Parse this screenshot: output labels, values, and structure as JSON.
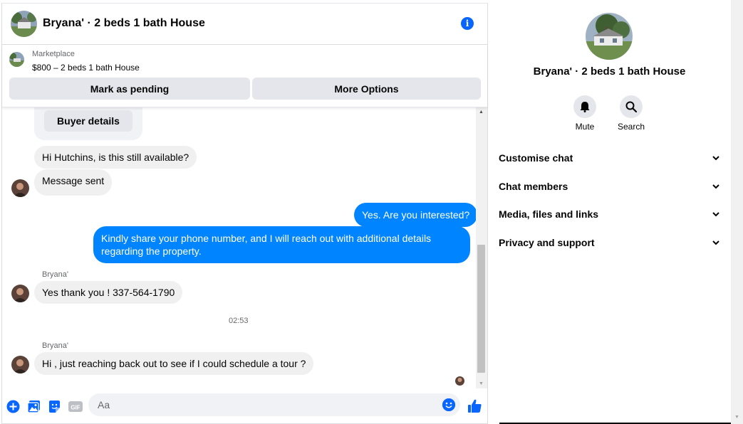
{
  "header": {
    "title": "Bryana' · 2 beds 1 bath House"
  },
  "listing": {
    "kind": "Marketplace",
    "summary": "$800 – 2 beds 1 bath House",
    "mark_pending_label": "Mark as pending",
    "more_options_label": "More Options"
  },
  "thread": {
    "buyer_details_label": "Buyer details",
    "messages": [
      {
        "direction": "in",
        "text": "Hi Hutchins, is this still available?"
      },
      {
        "direction": "in",
        "text": "Message sent"
      },
      {
        "direction": "out",
        "text": "Yes. Are you interested?"
      },
      {
        "direction": "out",
        "text": "Kindly share your phone number, and I will reach out with additional details regarding the property."
      },
      {
        "direction": "in",
        "sender": "Bryana'",
        "text": "Yes thank you !  337-564-1790"
      },
      {
        "direction": "in",
        "sender": "Bryana'",
        "text": "Hi , just reaching back out to see if I could schedule a tour ?"
      }
    ],
    "timestamp": "02:53"
  },
  "composer": {
    "placeholder": "Aa",
    "icons": [
      "plus-icon",
      "photo-icon",
      "sticker-icon",
      "gif-icon",
      "emoji-icon",
      "thumbs-up-icon"
    ],
    "gif_label": "GIF"
  },
  "details": {
    "name": "Bryana' · 2 beds 1 bath House",
    "actions": [
      {
        "label": "Mute",
        "icon": "bell-icon"
      },
      {
        "label": "Search",
        "icon": "search-icon"
      }
    ],
    "sections": [
      {
        "label": "Customise chat"
      },
      {
        "label": "Chat members"
      },
      {
        "label": "Media, files and links"
      },
      {
        "label": "Privacy and support"
      }
    ]
  },
  "colors": {
    "accent": "#0866ff",
    "outgoing_bubble": "#0084ff",
    "incoming_bubble": "#f0f0f0",
    "button_bg": "#e4e6eb"
  }
}
